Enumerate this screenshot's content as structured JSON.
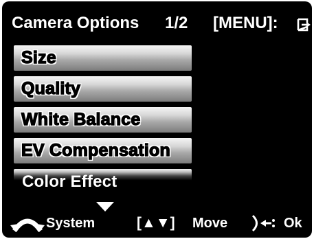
{
  "header": {
    "title": "Camera Options",
    "page": "1/2",
    "menu_hint": "[MENU]:",
    "exit_icon": "exit-arrow-icon"
  },
  "menu": {
    "items": [
      {
        "label": "Size",
        "selected": false
      },
      {
        "label": "Quality",
        "selected": false
      },
      {
        "label": "White Balance",
        "selected": false
      },
      {
        "label": "EV Compensation",
        "selected": false
      },
      {
        "label": "Color Effect",
        "selected": true
      }
    ]
  },
  "footer": {
    "system_label": "System",
    "move_keys": "[▲▼]",
    "move_label": "Move",
    "ok_label": "Ok",
    "system_icon": "dial-arrows-icon",
    "ok_icon": "ok-button-icon"
  },
  "colors": {
    "background": "#000000",
    "text": "#ffffff"
  }
}
